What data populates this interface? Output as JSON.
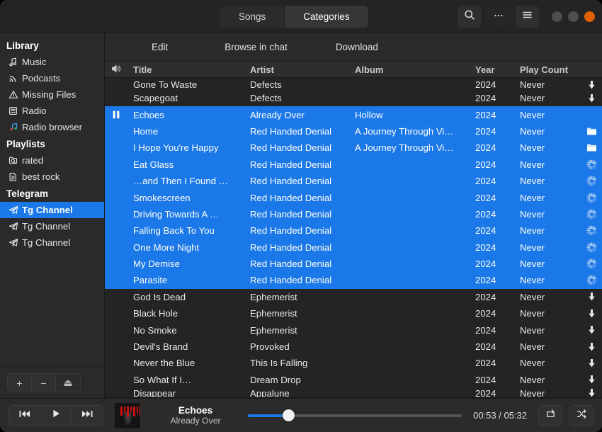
{
  "header": {
    "segments": [
      {
        "label": "Songs",
        "active": false
      },
      {
        "label": "Categories",
        "active": true
      }
    ],
    "search_icon": "search-icon",
    "more_icon": "more-options-icon",
    "menu_icon": "hamburger-menu-icon",
    "window_buttons": [
      "minimize",
      "maximize",
      "close"
    ],
    "close_color": "#e06000"
  },
  "sidebar": {
    "sections": [
      {
        "title": "Library",
        "items": [
          {
            "label": "Music",
            "icon": "music-note-icon",
            "selected": false
          },
          {
            "label": "Podcasts",
            "icon": "podcast-icon",
            "selected": false
          },
          {
            "label": "Missing Files",
            "icon": "warning-triangle-icon",
            "selected": false
          },
          {
            "label": "Radio",
            "icon": "radio-icon",
            "selected": false
          },
          {
            "label": "Radio browser",
            "icon": "radio-browser-icon",
            "selected": false
          }
        ]
      },
      {
        "title": "Playlists",
        "items": [
          {
            "label": "rated",
            "icon": "smart-playlist-icon",
            "selected": false
          },
          {
            "label": "best rock",
            "icon": "playlist-file-icon",
            "selected": false
          }
        ]
      },
      {
        "title": "Telegram",
        "items": [
          {
            "label": "Tg Channel",
            "icon": "telegram-icon",
            "selected": true
          },
          {
            "label": "Tg Channel",
            "icon": "telegram-icon",
            "selected": false
          },
          {
            "label": "Tg Channel",
            "icon": "telegram-icon",
            "selected": false
          }
        ]
      }
    ],
    "footer_buttons": [
      {
        "label": "+",
        "name": "add-playlist-button"
      },
      {
        "label": "−",
        "name": "remove-playlist-button"
      },
      {
        "label": "⏏",
        "name": "eject-button"
      }
    ]
  },
  "subtoolbar": {
    "edit_label": "Edit",
    "browse_label": "Browse in chat",
    "download_label": "Download"
  },
  "table": {
    "columns": {
      "speaker": "speaker-icon",
      "title": "Title",
      "artist": "Artist",
      "album": "Album",
      "year": "Year",
      "plays": "Play Count"
    },
    "rows": [
      {
        "title": "Gone To Waste",
        "artist": "Defects",
        "album": "",
        "year": "2024",
        "plays": "Never",
        "icon": "download-icon",
        "selected": false,
        "playing": false,
        "partial_top": true
      },
      {
        "title": "Scapegoat",
        "artist": "Defects",
        "album": "",
        "year": "2024",
        "plays": "Never",
        "icon": "download-icon",
        "selected": false,
        "playing": false
      },
      {
        "title": "Echoes",
        "artist": "Already Over",
        "album": "Hollow",
        "year": "2024",
        "plays": "Never",
        "icon": "",
        "selected": true,
        "playing": true
      },
      {
        "title": "Home",
        "artist": "Red Handed Denial",
        "album": "A Journey Through Vi…",
        "year": "2024",
        "plays": "Never",
        "icon": "folder-icon",
        "selected": true,
        "playing": false
      },
      {
        "title": "I Hope You're Happy",
        "artist": "Red Handed Denial",
        "album": "A Journey Through Vi…",
        "year": "2024",
        "plays": "Never",
        "icon": "folder-icon",
        "selected": true,
        "playing": false
      },
      {
        "title": "Eat Glass",
        "artist": "Red Handed Denial",
        "album": "",
        "year": "2024",
        "plays": "Never",
        "icon": "spinner-icon",
        "selected": true,
        "playing": false
      },
      {
        "title": "…and Then I Found …",
        "artist": "Red Handed Denial",
        "album": "",
        "year": "2024",
        "plays": "Never",
        "icon": "spinner-icon",
        "selected": true,
        "playing": false
      },
      {
        "title": "Smokescreen",
        "artist": "Red Handed Denial",
        "album": "",
        "year": "2024",
        "plays": "Never",
        "icon": "spinner-icon",
        "selected": true,
        "playing": false
      },
      {
        "title": "Driving Towards A …",
        "artist": "Red Handed Denial",
        "album": "",
        "year": "2024",
        "plays": "Never",
        "icon": "spinner-icon",
        "selected": true,
        "playing": false
      },
      {
        "title": "Falling Back To You",
        "artist": "Red Handed Denial",
        "album": "",
        "year": "2024",
        "plays": "Never",
        "icon": "spinner-icon",
        "selected": true,
        "playing": false
      },
      {
        "title": "One More Night",
        "artist": "Red Handed Denial",
        "album": "",
        "year": "2024",
        "plays": "Never",
        "icon": "spinner-icon",
        "selected": true,
        "playing": false
      },
      {
        "title": "My Demise",
        "artist": "Red Handed Denial",
        "album": "",
        "year": "2024",
        "plays": "Never",
        "icon": "spinner-icon",
        "selected": true,
        "playing": false
      },
      {
        "title": "Parasite",
        "artist": "Red Handed Denial",
        "album": "",
        "year": "2024",
        "plays": "Never",
        "icon": "spinner-icon",
        "selected": true,
        "playing": false
      },
      {
        "title": "God Is Dead",
        "artist": "Ephemerist",
        "album": "",
        "year": "2024",
        "plays": "Never",
        "icon": "download-icon",
        "selected": false,
        "playing": false
      },
      {
        "title": "Black Hole",
        "artist": "Ephemerist",
        "album": "",
        "year": "2024",
        "plays": "Never",
        "icon": "download-icon",
        "selected": false,
        "playing": false
      },
      {
        "title": "No Smoke",
        "artist": "Ephemerist",
        "album": "",
        "year": "2024",
        "plays": "Never",
        "icon": "download-icon",
        "selected": false,
        "playing": false
      },
      {
        "title": "Devil's Brand",
        "artist": "Provoked",
        "album": "",
        "year": "2024",
        "plays": "Never",
        "icon": "download-icon",
        "selected": false,
        "playing": false
      },
      {
        "title": "Never the Blue",
        "artist": "This Is Falling",
        "album": "",
        "year": "2024",
        "plays": "Never",
        "icon": "download-icon",
        "selected": false,
        "playing": false
      },
      {
        "title": "So What If I…",
        "artist": "Dream Drop",
        "album": "",
        "year": "2024",
        "plays": "Never",
        "icon": "download-icon",
        "selected": false,
        "playing": false
      },
      {
        "title": "Disappear",
        "artist": "Appalune",
        "album": "",
        "year": "2024",
        "plays": "Never",
        "icon": "download-icon",
        "selected": false,
        "playing": false,
        "partial_bottom": true
      }
    ]
  },
  "player": {
    "prev_icon": "previous-track-icon",
    "play_icon": "play-icon",
    "next_icon": "next-track-icon",
    "now_playing_title": "Echoes",
    "now_playing_artist": "Already Over",
    "elapsed": "00:53",
    "duration": "05:32",
    "time_display": "00:53 / 05:32",
    "progress_percent": 19,
    "repeat_icon": "repeat-icon",
    "shuffle_icon": "shuffle-icon"
  },
  "colors": {
    "accent": "#1b78e8",
    "close_button": "#e06000",
    "window_bg": "#242424",
    "sidebar_bg": "#2a2a2a"
  }
}
